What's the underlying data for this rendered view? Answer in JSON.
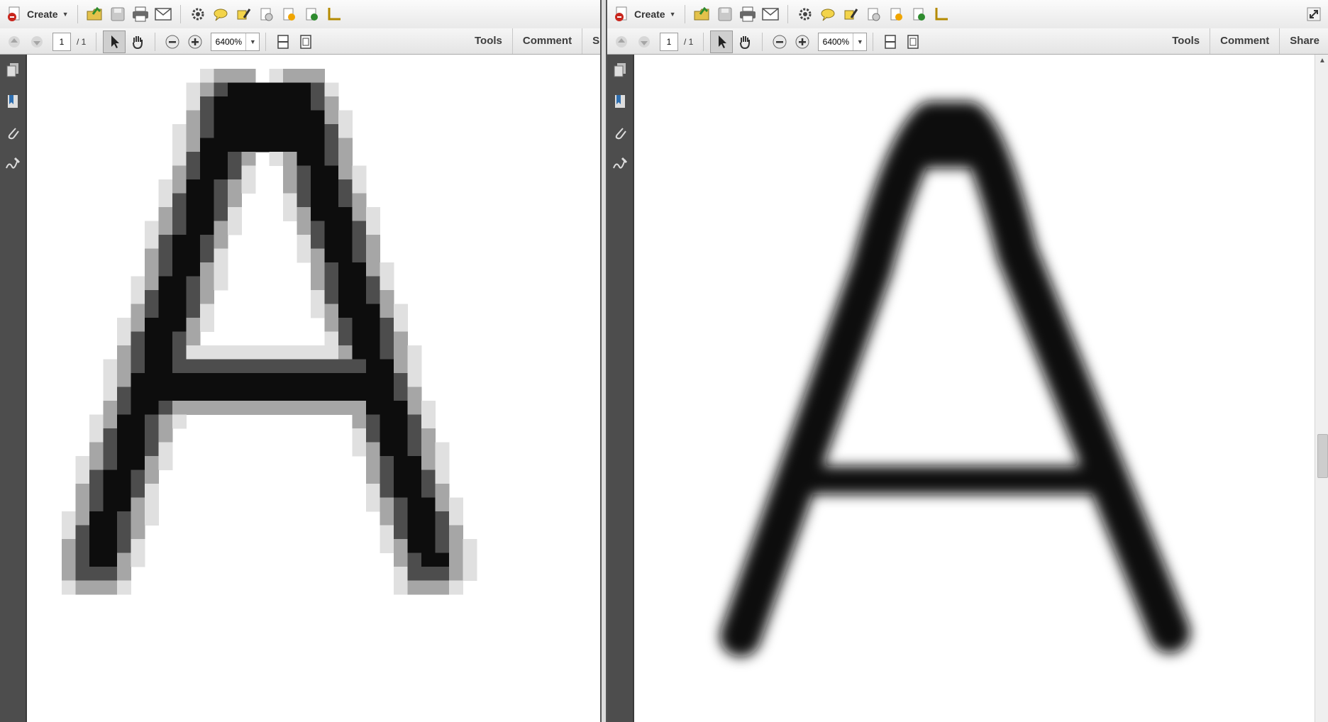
{
  "panes": [
    {
      "id": "left",
      "create_label": "Create",
      "page_current": "1",
      "page_total": "/ 1",
      "zoom_value": "6400%",
      "nav": [
        "Tools",
        "Comment",
        "S"
      ],
      "rendering": "pixelated"
    },
    {
      "id": "right",
      "create_label": "Create",
      "page_current": "1",
      "page_total": "/ 1",
      "zoom_value": "6400%",
      "nav": [
        "Tools",
        "Comment",
        "Share"
      ],
      "rendering": "smooth"
    }
  ],
  "colors": {
    "rail": "#4d4d4d",
    "ink": "#111111",
    "toolbar_bg": "#efefef"
  },
  "icons": {
    "toolbar_main": [
      "open-folder-icon",
      "save-icon",
      "print-icon",
      "email-icon",
      "settings-icon",
      "comment-icon",
      "highlight-icon",
      "redact-icon",
      "attach-doc-icon",
      "export-icon",
      "measure-icon"
    ],
    "toolbar_nav": [
      "prev-page-icon",
      "next-page-icon",
      "select-tool-icon",
      "hand-tool-icon",
      "zoom-out-icon",
      "zoom-in-icon",
      "fit-width-icon",
      "fit-page-icon"
    ],
    "rail": [
      "pages-icon",
      "bookmarks-icon",
      "attachments-icon",
      "signatures-icon"
    ]
  }
}
